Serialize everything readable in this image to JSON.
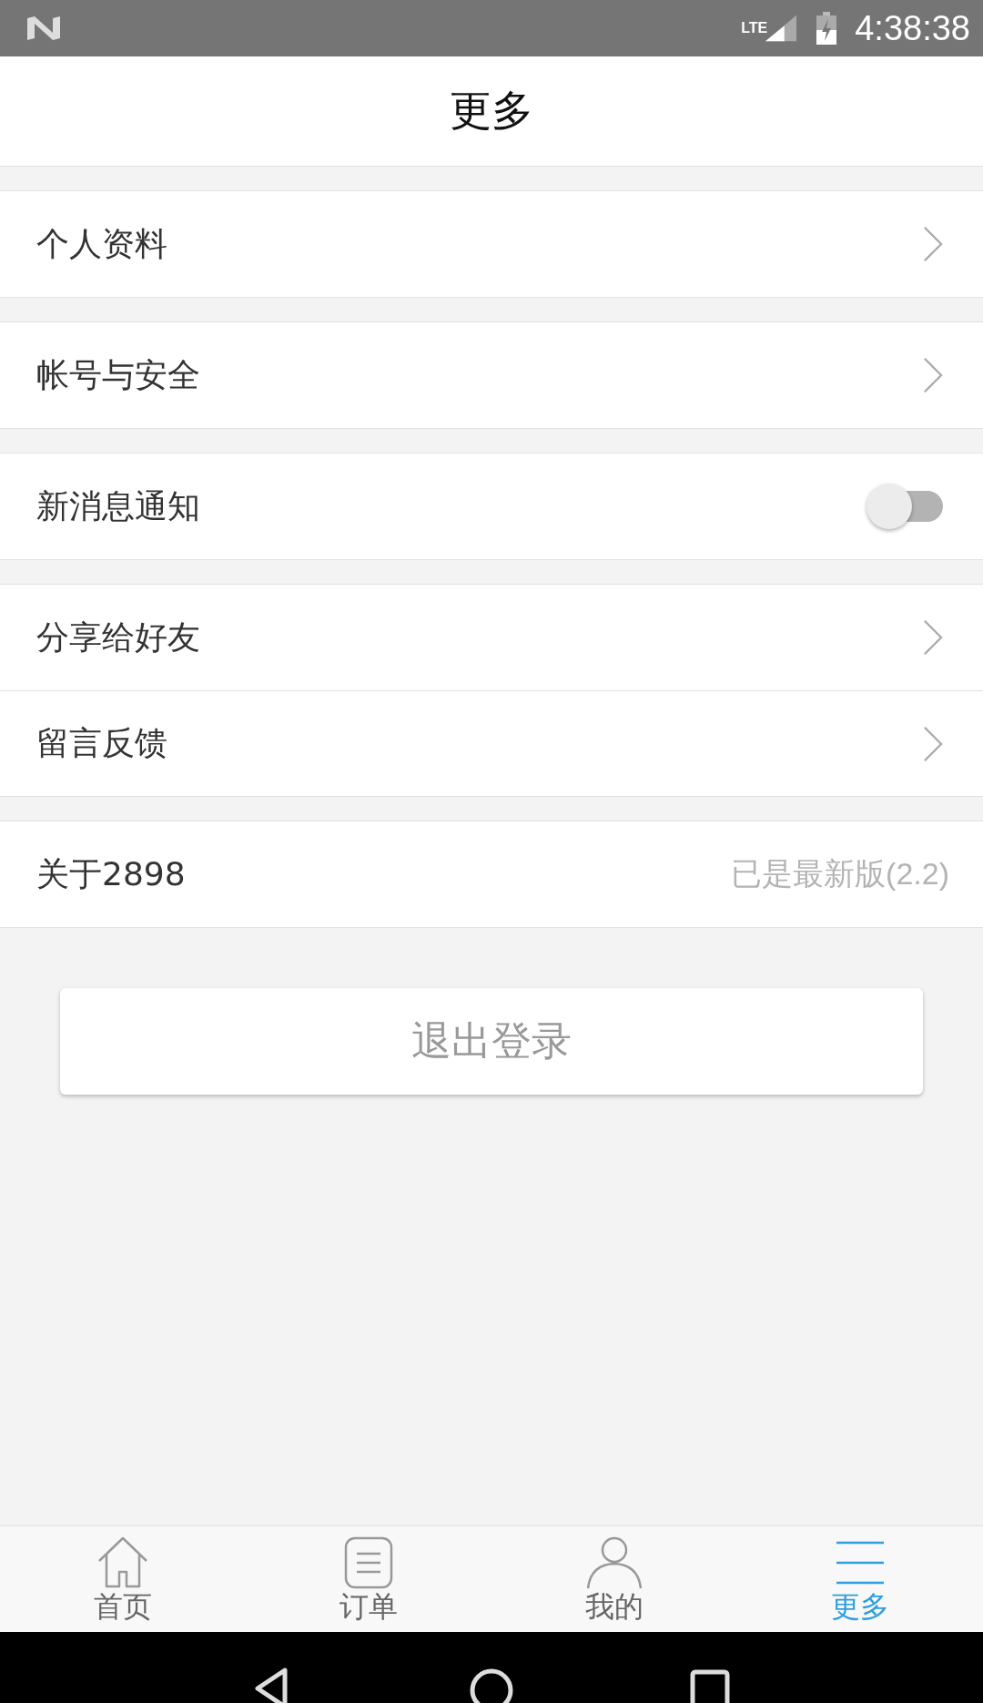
{
  "status_bar": {
    "time": "4:38:38",
    "network": "LTE"
  },
  "header": {
    "title": "更多"
  },
  "groups": [
    {
      "items": [
        {
          "kind": "link",
          "label": "个人资料"
        }
      ]
    },
    {
      "items": [
        {
          "kind": "link",
          "label": "帐号与安全"
        }
      ]
    },
    {
      "items": [
        {
          "kind": "toggle",
          "label": "新消息通知",
          "on": false
        }
      ]
    },
    {
      "items": [
        {
          "kind": "link",
          "label": "分享给好友"
        },
        {
          "kind": "link",
          "label": "留言反馈"
        }
      ]
    },
    {
      "items": [
        {
          "kind": "info",
          "label": "关于2898",
          "value": "已是最新版(2.2)"
        }
      ]
    }
  ],
  "logout_button": "退出登录",
  "tabs": [
    {
      "label": "首页",
      "kind": "home",
      "selected": false
    },
    {
      "label": "订单",
      "kind": "list",
      "selected": false
    },
    {
      "label": "我的",
      "kind": "person",
      "selected": false
    },
    {
      "label": "更多",
      "kind": "menu",
      "selected": true
    }
  ]
}
